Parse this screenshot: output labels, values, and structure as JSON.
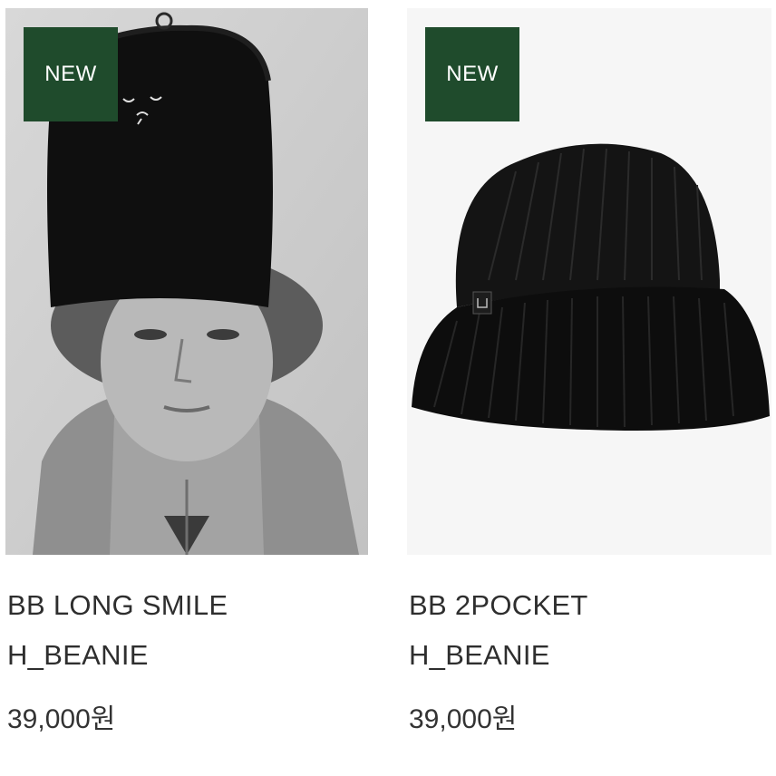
{
  "products": [
    {
      "badge": "NEW",
      "name_line1": "BB LONG SMILE",
      "name_line2": "H_BEANIE",
      "price": "39,000원"
    },
    {
      "badge": "NEW",
      "name_line1": "BB 2POCKET",
      "name_line2": "H_BEANIE",
      "price": "39,000원"
    }
  ],
  "colors": {
    "badge_bg": "#1f4b2c",
    "badge_text": "#ffffff",
    "text": "#2e2e2e"
  },
  "icons": [
    "model-photo",
    "beanie-product-photo"
  ]
}
